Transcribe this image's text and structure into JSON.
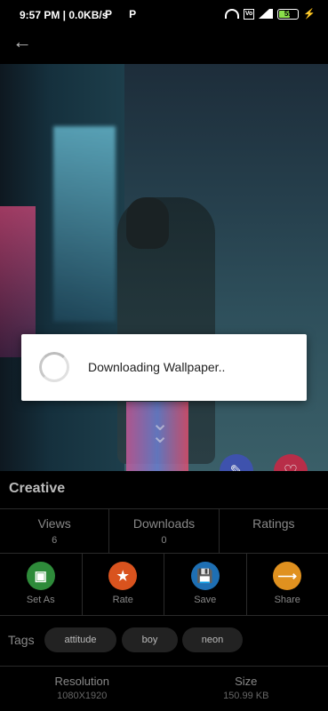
{
  "status_bar": {
    "time": "9:57 PM | 0.0KB/s",
    "p_icons": "P P",
    "battery": "55"
  },
  "hero": {
    "scroll_hint_icon": "double-chevron-down-icon"
  },
  "dialog": {
    "message": "Downloading Wallpaper.."
  },
  "wallpaper": {
    "category": "Creative",
    "stats": [
      {
        "label": "Views",
        "value": "6"
      },
      {
        "label": "Downloads",
        "value": "0"
      },
      {
        "label": "Ratings",
        "value": ""
      }
    ],
    "actions": [
      {
        "label": "Set As",
        "icon": "crop-icon",
        "color": "#2e8b3a"
      },
      {
        "label": "Rate",
        "icon": "star-icon",
        "color": "#d9531e"
      },
      {
        "label": "Save",
        "icon": "save-icon",
        "color": "#1e6fb3"
      },
      {
        "label": "Share",
        "icon": "share-icon",
        "color": "#e0911f"
      }
    ],
    "tags_label": "Tags",
    "tags": [
      "attitude",
      "boy",
      "neon"
    ],
    "specs": [
      {
        "label": "Resolution",
        "value": "1080X1920"
      },
      {
        "label": "Size",
        "value": "150.99 KB"
      }
    ]
  }
}
